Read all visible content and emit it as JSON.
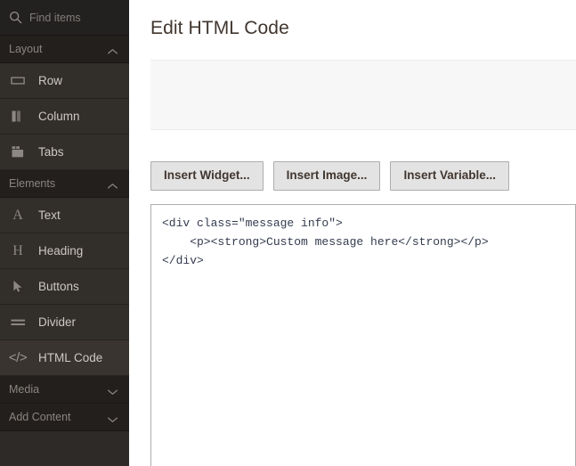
{
  "sidebar": {
    "search": {
      "placeholder": "Find items",
      "value": "",
      "icon": "search-icon"
    },
    "sections": [
      {
        "label": "Layout",
        "expanded": true,
        "chevron": "chevron-up-icon",
        "items": [
          {
            "label": "Row",
            "icon": "row-icon",
            "active": false
          },
          {
            "label": "Column",
            "icon": "column-icon",
            "active": false
          },
          {
            "label": "Tabs",
            "icon": "tabs-icon",
            "active": false
          }
        ]
      },
      {
        "label": "Elements",
        "expanded": true,
        "chevron": "chevron-up-icon",
        "items": [
          {
            "label": "Text",
            "icon": "text-icon",
            "active": false
          },
          {
            "label": "Heading",
            "icon": "heading-icon",
            "active": false
          },
          {
            "label": "Buttons",
            "icon": "cursor-arrow-icon",
            "active": false
          },
          {
            "label": "Divider",
            "icon": "divider-icon",
            "active": false
          },
          {
            "label": "HTML Code",
            "icon": "code-brackets-icon",
            "active": true
          }
        ]
      },
      {
        "label": "Media",
        "expanded": false,
        "chevron": "chevron-down-icon",
        "items": []
      },
      {
        "label": "Add Content",
        "expanded": false,
        "chevron": "chevron-down-icon",
        "items": []
      }
    ]
  },
  "main": {
    "title": "Edit HTML Code",
    "buttons": [
      {
        "label": "Insert Widget..."
      },
      {
        "label": "Insert Image..."
      },
      {
        "label": "Insert Variable..."
      }
    ],
    "code_editor": {
      "value": "<div class=\"message info\">\n    <p><strong>Custom message here</strong></p>\n</div>",
      "placeholder": ""
    }
  },
  "colors": {
    "sidebar_bg": "#2e2a27",
    "sidebar_item_bg": "#322e2a",
    "sidebar_section_bg": "#231f1d",
    "sidebar_active_bg": "#393430",
    "text_light": "#cdc8c3",
    "text_muted": "#8a8581",
    "title": "#41362f",
    "button_bg": "#e3e3e3",
    "button_border": "#adadad",
    "panel_bg": "#f7f7f7",
    "code_text": "#333b4d"
  }
}
